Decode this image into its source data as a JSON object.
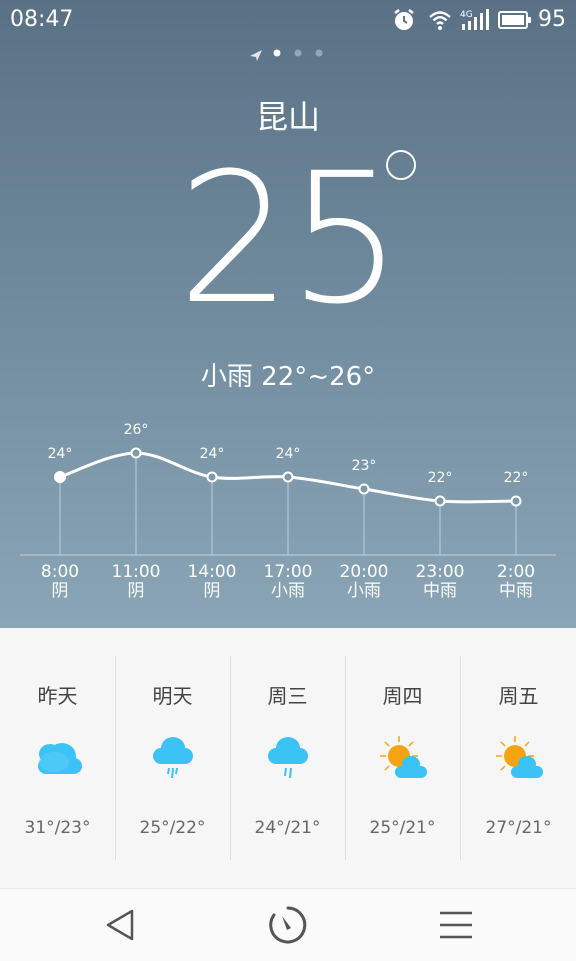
{
  "status_bar": {
    "time": "08:47",
    "network": "4G",
    "battery": "95"
  },
  "location": {
    "city": "昆山",
    "page_dots": 3,
    "active_dot": 1
  },
  "current": {
    "temperature": "25",
    "condition_range": "小雨 22°~26°"
  },
  "hourly": [
    {
      "time": "8:00",
      "temp_label": "24°",
      "temp": 24,
      "condition": "阴"
    },
    {
      "time": "11:00",
      "temp_label": "26°",
      "temp": 26,
      "condition": "阴"
    },
    {
      "time": "14:00",
      "temp_label": "24°",
      "temp": 24,
      "condition": "阴"
    },
    {
      "time": "17:00",
      "temp_label": "24°",
      "temp": 24,
      "condition": "小雨"
    },
    {
      "time": "20:00",
      "temp_label": "23°",
      "temp": 23,
      "condition": "小雨"
    },
    {
      "time": "23:00",
      "temp_label": "22°",
      "temp": 22,
      "condition": "中雨"
    },
    {
      "time": "2:00",
      "temp_label": "22°",
      "temp": 22,
      "condition": "中雨"
    }
  ],
  "daily": [
    {
      "day": "昨天",
      "icon": "cloudy-icon",
      "range": "31°/23°"
    },
    {
      "day": "明天",
      "icon": "rain-icon",
      "range": "25°/22°"
    },
    {
      "day": "周三",
      "icon": "rain-icon",
      "range": "24°/21°"
    },
    {
      "day": "周四",
      "icon": "partly-sunny-icon",
      "range": "25°/21°"
    },
    {
      "day": "周五",
      "icon": "partly-sunny-icon",
      "range": "27°/21°"
    }
  ],
  "nav": {
    "back": "back-icon",
    "home": "home-icon",
    "menu": "menu-icon"
  },
  "colors": {
    "cloud": "#3cc3f5",
    "sun": "#f6a312",
    "top_gradient_start": "#5a7185",
    "top_gradient_end": "#8aa6b6"
  }
}
